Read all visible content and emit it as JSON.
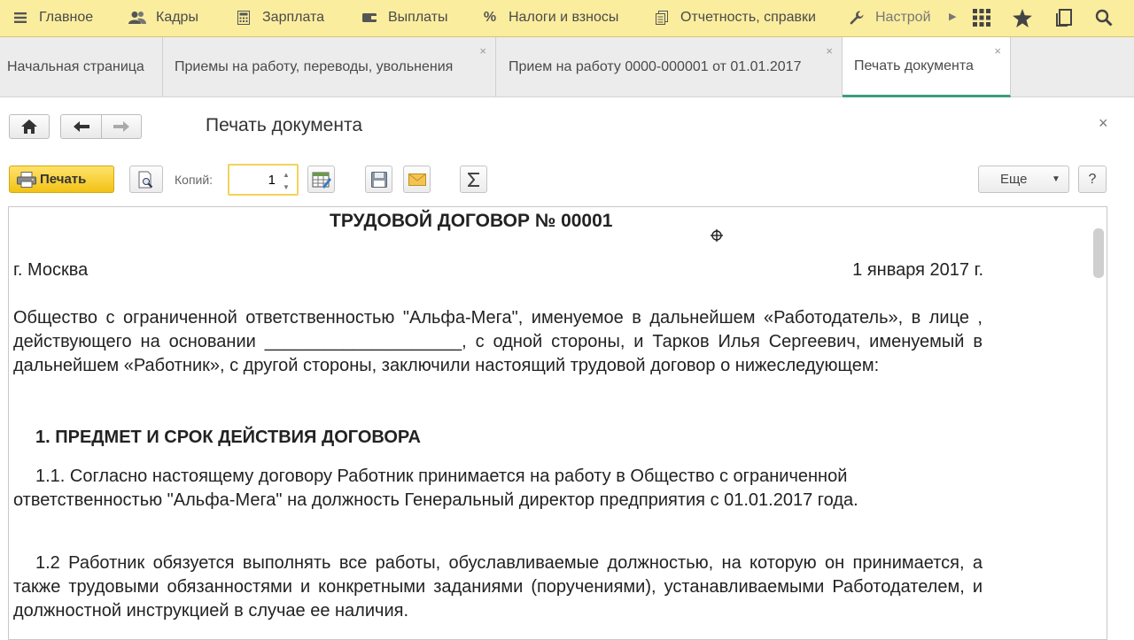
{
  "top_menu": {
    "items": [
      {
        "label": "Главное",
        "icon": "hamburger-icon"
      },
      {
        "label": "Кадры",
        "icon": "people-icon"
      },
      {
        "label": "Зарплата",
        "icon": "calculator-icon"
      },
      {
        "label": "Выплаты",
        "icon": "wallet-icon"
      },
      {
        "label": "Налоги и взносы",
        "icon": "percent-icon"
      },
      {
        "label": "Отчетность, справки",
        "icon": "reports-icon"
      },
      {
        "label": "Настрой",
        "icon": "wrench-icon"
      }
    ],
    "right_icons": [
      "grid-icon",
      "star-icon",
      "history-icon",
      "search-icon"
    ]
  },
  "tabs": [
    {
      "label": "Начальная страница",
      "closable": false,
      "active": false
    },
    {
      "label": "Приемы на работу, переводы, увольнения",
      "closable": true,
      "active": false
    },
    {
      "label": "Прием на работу 0000-000001 от 01.01.2017",
      "closable": true,
      "active": false
    },
    {
      "label": "Печать документа",
      "closable": true,
      "active": true
    }
  ],
  "form": {
    "title": "Печать документа",
    "close_glyph": "×"
  },
  "toolbar": {
    "print_label": "Печать",
    "copies_label": "Копий:",
    "copies_value": "1",
    "more_label": "Еще",
    "help_label": "?"
  },
  "document": {
    "title": "ТРУДОВОЙ ДОГОВОР № 00001",
    "city": "г. Москва",
    "date": "1 января 2017 г.",
    "intro": "Общество с ограниченной ответственностью \"Альфа-Мега\", именуемое в дальнейшем «Работодатель», в лице , действующего на основании ____________________, с одной стороны, и Тарков Илья Сергеевич, именуемый в дальнейшем «Работник», с другой стороны, заключили настоящий трудовой договор о нижеследующем:",
    "section1_heading": "1. ПРЕДМЕТ И СРОК ДЕЙСТВИЯ ДОГОВОРА",
    "clause_1_1": "1.1. Согласно настоящему договору Работник принимается на работу в Общество с ограниченной ответственностью \"Альфа-Мега\" на должность Генеральный директор предприятия с 01.01.2017 года.",
    "clause_1_2": "1.2 Работник обязуется выполнять все работы, обуславливаемые должностью, на которую он принимается, а также трудовыми обязанностями и конкретными заданиями (поручениями), устанавливаемыми Работодателем, и должностной инструкцией в случае ее наличия."
  }
}
